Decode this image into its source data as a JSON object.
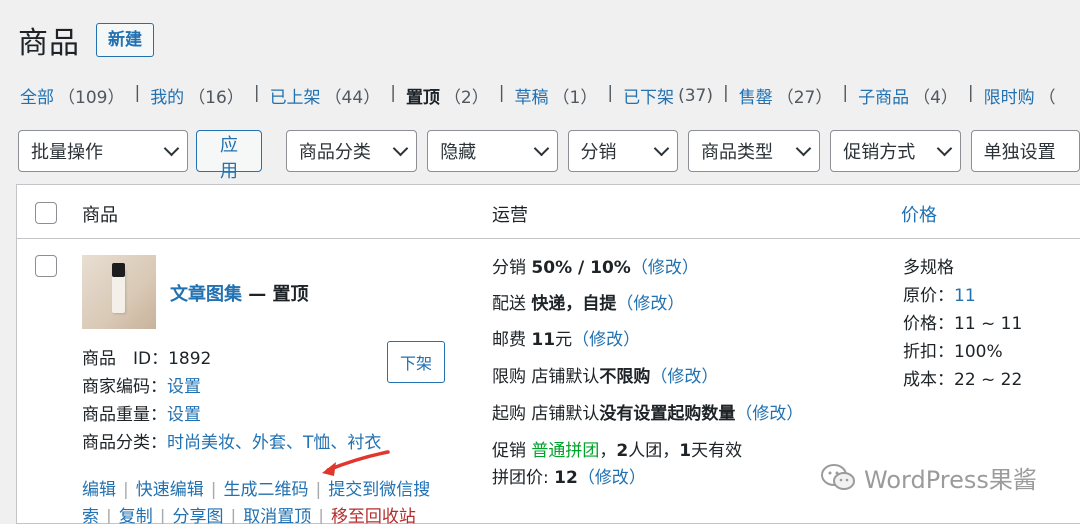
{
  "header": {
    "title": "商品",
    "add_new": "新建"
  },
  "views": [
    {
      "label": "全部",
      "count": "（109）",
      "current": false
    },
    {
      "label": "我的",
      "count": "（16）",
      "current": false
    },
    {
      "label": "已上架",
      "count": "（44）",
      "current": false
    },
    {
      "label": "置顶",
      "count": "（2）",
      "current": true
    },
    {
      "label": "草稿",
      "count": "（1）",
      "current": false
    },
    {
      "label": "已下架",
      "count": "(37)",
      "current": false
    },
    {
      "label": "售罄",
      "count": "（27）",
      "current": false
    },
    {
      "label": "子商品",
      "count": "（4）",
      "current": false
    },
    {
      "label": "限时购",
      "count": "（",
      "current": false
    }
  ],
  "filters": {
    "bulk_action": "批量操作",
    "apply": "应用",
    "category": "商品分类",
    "hidden": "隐藏",
    "distribution": "分销",
    "product_type": "商品类型",
    "promotion": "促销方式",
    "single_setting": "单独设置"
  },
  "table": {
    "columns": {
      "product": "商品",
      "operations": "运营",
      "price": "价格"
    }
  },
  "product": {
    "name": "文章图集",
    "state": " — 置顶",
    "id_label": "商品　ID：",
    "id_value": "1892",
    "merchant_code_label": "商家编码：",
    "merchant_code_value": "设置",
    "weight_label": "商品重量：",
    "weight_value": "设置",
    "category_label": "商品分类：",
    "category_value": "时尚美妆、外套、T恤、衬衣",
    "unpublish_button": "下架",
    "actions_line1": [
      "编辑",
      "快速编辑",
      "生成二维码",
      "提交到微信搜"
    ],
    "actions_line2": [
      "索",
      "复制",
      "分享图",
      "取消置顶"
    ],
    "trash": "移至回收站"
  },
  "operations": {
    "distribution_label": "分销",
    "distribution_value": "50% / 10%",
    "delivery_label": "配送",
    "delivery_value": "快递，自提",
    "postage_label": "邮费",
    "postage_value": "11",
    "postage_unit": "元",
    "limit_label": "限购",
    "limit_prefix": "店铺默认",
    "limit_value": "不限购",
    "min_label": "起购",
    "min_prefix": "店铺默认",
    "min_value": "没有设置起购数量",
    "promo_label": "促销",
    "promo_type": "普通拼团",
    "promo_sep": "，",
    "promo_people": "2",
    "promo_people_unit": "人团，",
    "promo_days": "1",
    "promo_days_unit": "天有效",
    "group_price_label": "拼团价: ",
    "group_price_value": "12",
    "edit": "修改",
    "lparen": "（",
    "rparen": "）"
  },
  "price": {
    "multi_spec": "多规格",
    "original_label": "原价：",
    "original_value": "11",
    "price_label": "价格：",
    "price_value": "11 ~ 11",
    "discount_label": "折扣：",
    "discount_value": "100%",
    "cost_label": "成本：",
    "cost_value": "22 ~ 22"
  },
  "watermark": "WordPress果酱",
  "colors": {
    "link": "#2271b1",
    "danger": "#b32d2e",
    "green": "#00a32a",
    "arrow": "#e0362c"
  }
}
